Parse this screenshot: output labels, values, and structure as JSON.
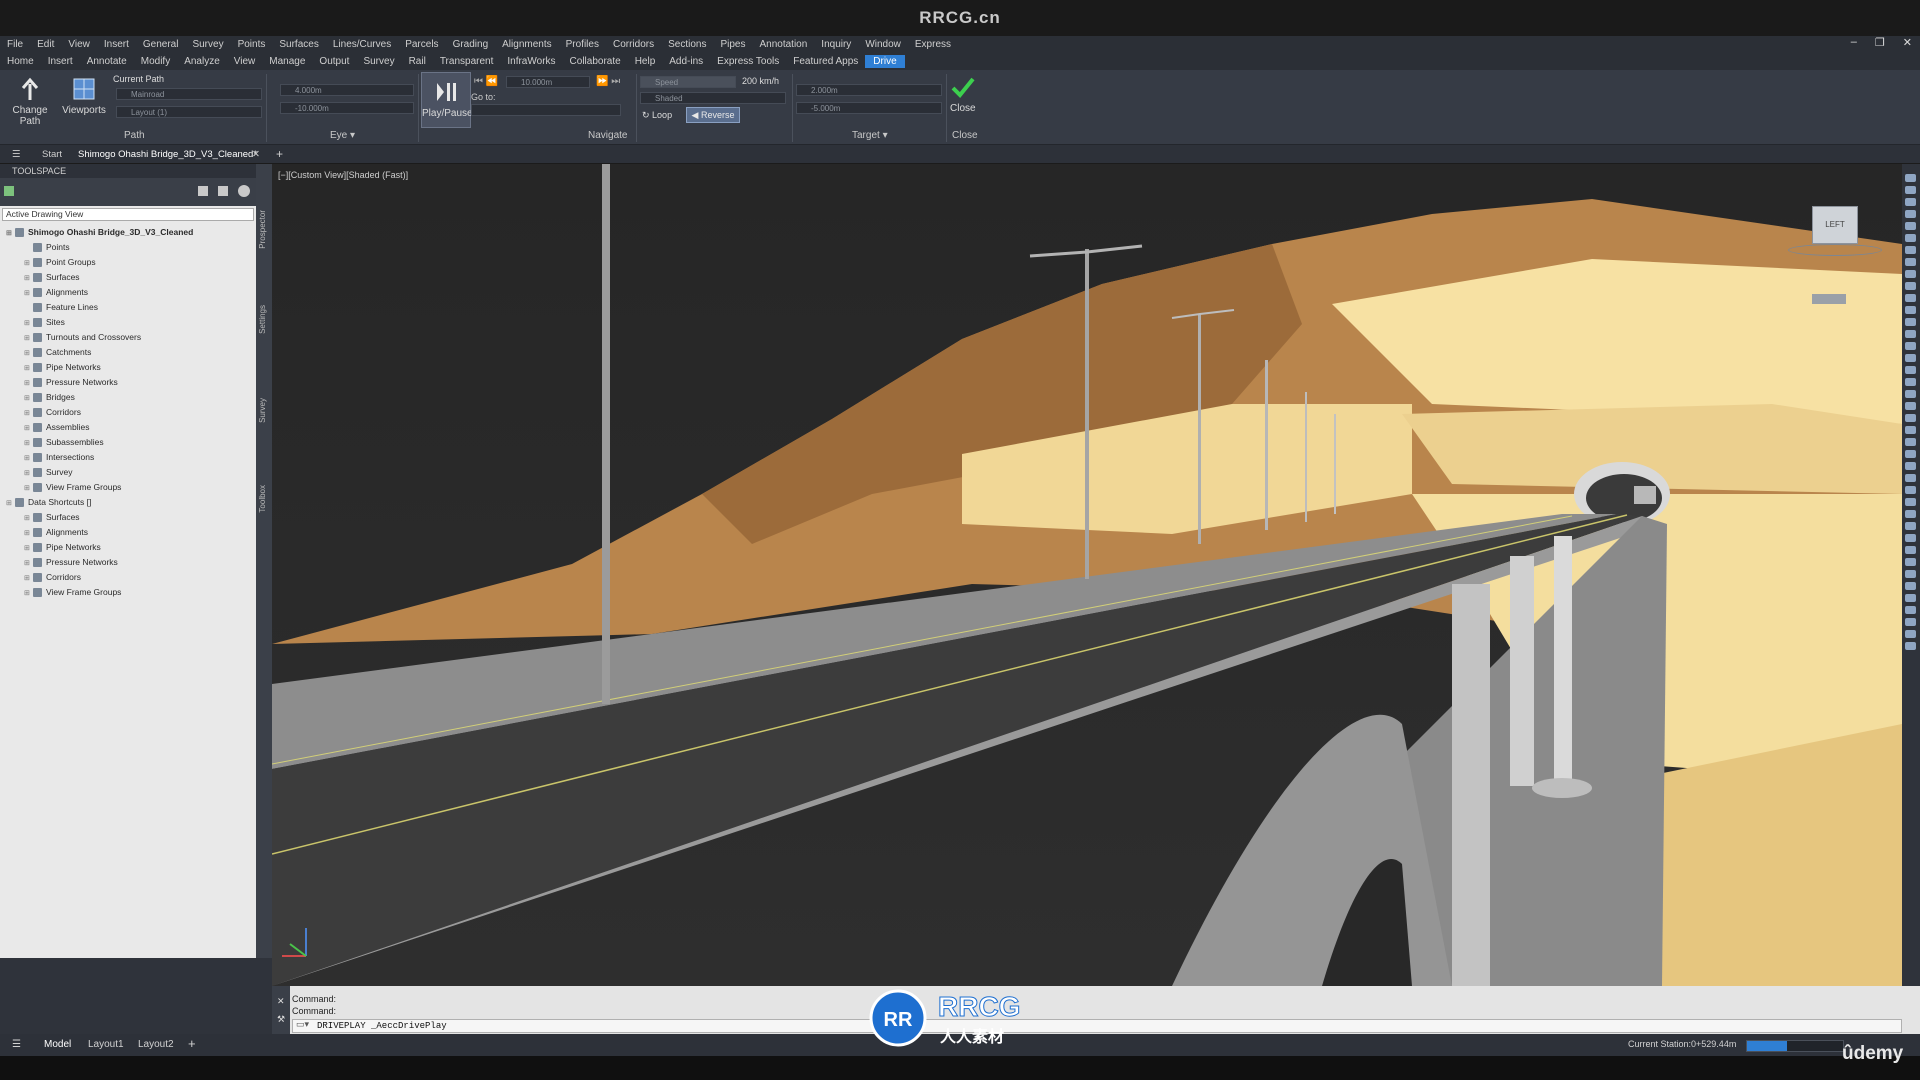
{
  "title_bar": {
    "watermark": "RRCG.cn"
  },
  "menu_bar_1": [
    "File",
    "Edit",
    "View",
    "Insert",
    "General",
    "Survey",
    "Points",
    "Surfaces",
    "Lines/Curves",
    "Parcels",
    "Grading",
    "Alignments",
    "Profiles",
    "Corridors",
    "Sections",
    "Pipes",
    "Annotation",
    "Inquiry",
    "Window",
    "Express"
  ],
  "menu_bar_2": [
    "Home",
    "Insert",
    "Annotate",
    "Modify",
    "Analyze",
    "View",
    "Manage",
    "Output",
    "Survey",
    "Rail",
    "Transparent",
    "InfraWorks",
    "Collaborate",
    "Help",
    "Add-ins",
    "Express Tools",
    "Featured Apps",
    "Drive"
  ],
  "menu_bar_2_active": "Drive",
  "ribbon": {
    "change_path": "Change Path",
    "viewports": "Viewports",
    "current_path": "Current Path",
    "current_path_items": [
      "Mainroad",
      "Layout (1)"
    ],
    "eye_height": "4.000m",
    "eye_offset": "-10.000m",
    "play_pause": "Play/Pause",
    "go_to": "Go to:",
    "station_step": "10.000m",
    "speed_label": "Speed",
    "speed_value": "200 km/h",
    "visual_style": "Shaded",
    "loop": "Loop",
    "reverse": "Reverse",
    "target_height": "2.000m",
    "target_offset": "-5.000m",
    "close": "Close",
    "panels": {
      "path": "Path",
      "eye": "Eye ▾",
      "navigate": "Navigate",
      "target": "Target ▾",
      "close": "Close"
    }
  },
  "tabs": {
    "start": "Start",
    "drawing": "Shimogo Ohashi Bridge_3D_V3_Cleaned*"
  },
  "toolspace": {
    "header": "TOOLSPACE",
    "view_combo": "Active Drawing View",
    "root": "Shimogo Ohashi Bridge_3D_V3_Cleaned",
    "items": [
      "Points",
      "Point Groups",
      "Surfaces",
      "Alignments",
      "Feature Lines",
      "Sites",
      "Turnouts and Crossovers",
      "Catchments",
      "Pipe Networks",
      "Pressure Networks",
      "Bridges",
      "Corridors",
      "Assemblies",
      "Subassemblies",
      "Intersections",
      "Survey",
      "View Frame Groups"
    ],
    "shortcuts_root": "Data Shortcuts []",
    "shortcut_items": [
      "Surfaces",
      "Alignments",
      "Pipe Networks",
      "Pressure Networks",
      "Corridors",
      "View Frame Groups"
    ],
    "side_tabs": [
      "Prospector",
      "Settings",
      "Survey",
      "Toolbox"
    ]
  },
  "viewport": {
    "label": "[−][Custom View][Shaded (Fast)]",
    "viewcube_face": "LEFT"
  },
  "command": {
    "line1": "Command:",
    "line2": "Command:",
    "input": "DRIVEPLAY _AeccDrivePlay"
  },
  "status": {
    "model": "Model",
    "layout1": "Layout1",
    "layout2": "Layout2",
    "current_station": "Current Station:0+529.44m",
    "progress": 0.42
  },
  "watermarks": {
    "logo_text": "RRCG",
    "logo_sub": "人人素材",
    "udemy": "ûdemy"
  },
  "colors": {
    "active_tab": "#2f7fd4",
    "terrain_top": "#c8955a",
    "terrain_cut": "#f6df9c",
    "road": "#3a3a3a",
    "sky": "#282828"
  }
}
